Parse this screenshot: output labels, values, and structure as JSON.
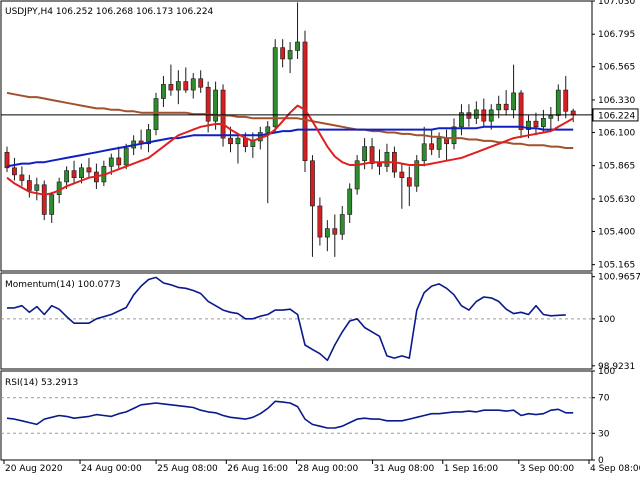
{
  "colors": {
    "background": "#ffffff",
    "frame": "#000000",
    "bull": "#2e8b2e",
    "bear": "#d42020",
    "wick": "#1a1a1a",
    "ma_fast": "#e02020",
    "ma_mid": "#1020c0",
    "ma_slow": "#a0522d",
    "indicator": "#0a1a8c",
    "level_line": "#9a9a9a",
    "price_tag_bg": "#ffffff",
    "price_tag_text": "#000000"
  },
  "chart_data": [
    {
      "type": "candlestick",
      "title": "USDJPY,H4  106.252 106.268 106.173 106.224",
      "ylim": [
        105.12,
        107.03
      ],
      "y_ticks": [
        "107.030",
        "106.795",
        "106.565",
        "106.330",
        "106.100",
        "105.865",
        "105.630",
        "105.400",
        "105.165"
      ],
      "y_tick_values": [
        107.03,
        106.795,
        106.565,
        106.33,
        106.1,
        105.865,
        105.63,
        105.4,
        105.165
      ],
      "current_price": "106.224",
      "current_price_value": 106.224,
      "candles": [
        {
          "o": 105.96,
          "h": 106.0,
          "l": 105.82,
          "c": 105.85
        },
        {
          "o": 105.85,
          "h": 105.92,
          "l": 105.76,
          "c": 105.8
        },
        {
          "o": 105.8,
          "h": 105.86,
          "l": 105.72,
          "c": 105.76
        },
        {
          "o": 105.76,
          "h": 105.8,
          "l": 105.64,
          "c": 105.69
        },
        {
          "o": 105.69,
          "h": 105.78,
          "l": 105.62,
          "c": 105.73
        },
        {
          "o": 105.73,
          "h": 105.76,
          "l": 105.48,
          "c": 105.52
        },
        {
          "o": 105.52,
          "h": 105.68,
          "l": 105.46,
          "c": 105.66
        },
        {
          "o": 105.66,
          "h": 105.78,
          "l": 105.6,
          "c": 105.75
        },
        {
          "o": 105.75,
          "h": 105.86,
          "l": 105.7,
          "c": 105.83
        },
        {
          "o": 105.83,
          "h": 105.9,
          "l": 105.74,
          "c": 105.78
        },
        {
          "o": 105.78,
          "h": 105.88,
          "l": 105.74,
          "c": 105.85
        },
        {
          "o": 105.85,
          "h": 105.92,
          "l": 105.78,
          "c": 105.82
        },
        {
          "o": 105.82,
          "h": 105.88,
          "l": 105.7,
          "c": 105.75
        },
        {
          "o": 105.75,
          "h": 105.9,
          "l": 105.72,
          "c": 105.86
        },
        {
          "o": 105.86,
          "h": 105.95,
          "l": 105.8,
          "c": 105.92
        },
        {
          "o": 105.92,
          "h": 106.0,
          "l": 105.84,
          "c": 105.87
        },
        {
          "o": 105.87,
          "h": 106.02,
          "l": 105.84,
          "c": 105.99
        },
        {
          "o": 105.99,
          "h": 106.08,
          "l": 105.94,
          "c": 106.04
        },
        {
          "o": 106.04,
          "h": 106.12,
          "l": 105.98,
          "c": 106.02
        },
        {
          "o": 106.02,
          "h": 106.16,
          "l": 105.96,
          "c": 106.12
        },
        {
          "o": 106.12,
          "h": 106.38,
          "l": 106.08,
          "c": 106.34
        },
        {
          "o": 106.34,
          "h": 106.5,
          "l": 106.28,
          "c": 106.44
        },
        {
          "o": 106.44,
          "h": 106.58,
          "l": 106.36,
          "c": 106.4
        },
        {
          "o": 106.4,
          "h": 106.54,
          "l": 106.3,
          "c": 106.46
        },
        {
          "o": 106.46,
          "h": 106.56,
          "l": 106.38,
          "c": 106.4
        },
        {
          "o": 106.4,
          "h": 106.52,
          "l": 106.34,
          "c": 106.48
        },
        {
          "o": 106.48,
          "h": 106.54,
          "l": 106.38,
          "c": 106.42
        },
        {
          "o": 106.42,
          "h": 106.46,
          "l": 106.1,
          "c": 106.18
        },
        {
          "o": 106.18,
          "h": 106.46,
          "l": 106.12,
          "c": 106.4
        },
        {
          "o": 106.4,
          "h": 106.44,
          "l": 106.0,
          "c": 106.06
        },
        {
          "o": 106.06,
          "h": 106.14,
          "l": 105.96,
          "c": 106.02
        },
        {
          "o": 106.02,
          "h": 106.08,
          "l": 105.88,
          "c": 106.06
        },
        {
          "o": 106.06,
          "h": 106.1,
          "l": 105.96,
          "c": 106.0
        },
        {
          "o": 106.0,
          "h": 106.1,
          "l": 105.92,
          "c": 106.04
        },
        {
          "o": 106.04,
          "h": 106.14,
          "l": 105.98,
          "c": 106.1
        },
        {
          "o": 106.1,
          "h": 106.18,
          "l": 105.6,
          "c": 106.14
        },
        {
          "o": 106.14,
          "h": 106.76,
          "l": 106.1,
          "c": 106.7
        },
        {
          "o": 106.7,
          "h": 106.76,
          "l": 106.56,
          "c": 106.62
        },
        {
          "o": 106.62,
          "h": 106.74,
          "l": 106.52,
          "c": 106.68
        },
        {
          "o": 106.68,
          "h": 107.02,
          "l": 106.62,
          "c": 106.74
        },
        {
          "o": 106.74,
          "h": 106.82,
          "l": 105.82,
          "c": 105.9
        },
        {
          "o": 105.9,
          "h": 105.94,
          "l": 105.22,
          "c": 105.58
        },
        {
          "o": 105.58,
          "h": 105.64,
          "l": 105.3,
          "c": 105.36
        },
        {
          "o": 105.36,
          "h": 105.48,
          "l": 105.26,
          "c": 105.42
        },
        {
          "o": 105.42,
          "h": 105.52,
          "l": 105.22,
          "c": 105.38
        },
        {
          "o": 105.38,
          "h": 105.58,
          "l": 105.34,
          "c": 105.52
        },
        {
          "o": 105.52,
          "h": 105.74,
          "l": 105.46,
          "c": 105.7
        },
        {
          "o": 105.7,
          "h": 105.94,
          "l": 105.66,
          "c": 105.9
        },
        {
          "o": 105.9,
          "h": 106.06,
          "l": 105.84,
          "c": 106.0
        },
        {
          "o": 106.0,
          "h": 106.06,
          "l": 105.84,
          "c": 105.88
        },
        {
          "o": 105.88,
          "h": 105.98,
          "l": 105.8,
          "c": 105.86
        },
        {
          "o": 105.86,
          "h": 106.02,
          "l": 105.82,
          "c": 105.96
        },
        {
          "o": 105.96,
          "h": 106.0,
          "l": 105.78,
          "c": 105.82
        },
        {
          "o": 105.82,
          "h": 105.88,
          "l": 105.56,
          "c": 105.78
        },
        {
          "o": 105.78,
          "h": 105.86,
          "l": 105.58,
          "c": 105.72
        },
        {
          "o": 105.72,
          "h": 105.94,
          "l": 105.68,
          "c": 105.9
        },
        {
          "o": 105.9,
          "h": 106.14,
          "l": 105.86,
          "c": 106.02
        },
        {
          "o": 106.02,
          "h": 106.12,
          "l": 105.94,
          "c": 105.98
        },
        {
          "o": 105.98,
          "h": 106.1,
          "l": 105.92,
          "c": 106.06
        },
        {
          "o": 106.06,
          "h": 106.12,
          "l": 105.9,
          "c": 106.02
        },
        {
          "o": 106.02,
          "h": 106.2,
          "l": 105.98,
          "c": 106.14
        },
        {
          "o": 106.14,
          "h": 106.3,
          "l": 106.08,
          "c": 106.24
        },
        {
          "o": 106.24,
          "h": 106.3,
          "l": 106.14,
          "c": 106.2
        },
        {
          "o": 106.2,
          "h": 106.32,
          "l": 106.16,
          "c": 106.26
        },
        {
          "o": 106.26,
          "h": 106.34,
          "l": 106.14,
          "c": 106.18
        },
        {
          "o": 106.18,
          "h": 106.3,
          "l": 106.12,
          "c": 106.26
        },
        {
          "o": 106.26,
          "h": 106.36,
          "l": 106.2,
          "c": 106.3
        },
        {
          "o": 106.3,
          "h": 106.4,
          "l": 106.22,
          "c": 106.26
        },
        {
          "o": 106.26,
          "h": 106.58,
          "l": 106.2,
          "c": 106.38
        },
        {
          "o": 106.38,
          "h": 106.4,
          "l": 106.06,
          "c": 106.12
        },
        {
          "o": 106.12,
          "h": 106.22,
          "l": 106.06,
          "c": 106.18
        },
        {
          "o": 106.18,
          "h": 106.24,
          "l": 106.08,
          "c": 106.14
        },
        {
          "o": 106.14,
          "h": 106.26,
          "l": 106.1,
          "c": 106.2
        },
        {
          "o": 106.2,
          "h": 106.28,
          "l": 106.12,
          "c": 106.22
        },
        {
          "o": 106.22,
          "h": 106.44,
          "l": 106.18,
          "c": 106.4
        },
        {
          "o": 106.4,
          "h": 106.5,
          "l": 106.2,
          "c": 106.25
        },
        {
          "o": 106.252,
          "h": 106.268,
          "l": 106.173,
          "c": 106.224
        }
      ],
      "ma_fast": [
        105.78,
        105.74,
        105.71,
        105.68,
        105.67,
        105.66,
        105.67,
        105.69,
        105.72,
        105.74,
        105.76,
        105.78,
        105.79,
        105.8,
        105.82,
        105.84,
        105.86,
        105.88,
        105.9,
        105.92,
        105.96,
        106.0,
        106.04,
        106.08,
        106.1,
        106.12,
        106.14,
        106.15,
        106.16,
        106.16,
        106.12,
        106.09,
        106.06,
        106.04,
        106.06,
        106.08,
        106.12,
        106.18,
        106.24,
        106.29,
        106.26,
        106.18,
        106.09,
        106.0,
        105.93,
        105.89,
        105.87,
        105.87,
        105.88,
        105.89,
        105.89,
        105.89,
        105.89,
        105.88,
        105.87,
        105.87,
        105.87,
        105.88,
        105.89,
        105.9,
        105.91,
        105.92,
        105.94,
        105.96,
        105.98,
        106.0,
        106.02,
        106.04,
        106.06,
        106.07,
        106.08,
        106.09,
        106.1,
        106.11,
        106.14,
        106.17,
        106.2
      ],
      "ma_mid": [
        105.86,
        105.87,
        105.88,
        105.88,
        105.89,
        105.89,
        105.9,
        105.91,
        105.92,
        105.93,
        105.94,
        105.95,
        105.96,
        105.97,
        105.98,
        105.99,
        106.0,
        106.01,
        106.02,
        106.03,
        106.04,
        106.05,
        106.06,
        106.06,
        106.07,
        106.08,
        106.08,
        106.08,
        106.08,
        106.08,
        106.08,
        106.08,
        106.08,
        106.08,
        106.08,
        106.09,
        106.1,
        106.11,
        106.11,
        106.12,
        106.12,
        106.12,
        106.12,
        106.12,
        106.12,
        106.12,
        106.12,
        106.12,
        106.12,
        106.12,
        106.12,
        106.12,
        106.12,
        106.12,
        106.12,
        106.12,
        106.12,
        106.12,
        106.13,
        106.13,
        106.13,
        106.13,
        106.13,
        106.13,
        106.14,
        106.14,
        106.14,
        106.14,
        106.14,
        106.14,
        106.13,
        106.13,
        106.12,
        106.12,
        106.12,
        106.12,
        106.12
      ],
      "ma_slow": [
        106.38,
        106.37,
        106.36,
        106.35,
        106.35,
        106.34,
        106.33,
        106.32,
        106.31,
        106.3,
        106.29,
        106.28,
        106.27,
        106.27,
        106.26,
        106.26,
        106.25,
        106.25,
        106.24,
        106.24,
        106.24,
        106.24,
        106.24,
        106.24,
        106.24,
        106.23,
        106.23,
        106.23,
        106.22,
        106.22,
        106.22,
        106.21,
        106.21,
        106.2,
        106.2,
        106.2,
        106.2,
        106.2,
        106.2,
        106.2,
        106.19,
        106.18,
        106.17,
        106.16,
        106.15,
        106.14,
        106.13,
        106.12,
        106.12,
        106.11,
        106.11,
        106.1,
        106.1,
        106.09,
        106.09,
        106.08,
        106.08,
        106.07,
        106.07,
        106.06,
        106.06,
        106.06,
        106.05,
        106.05,
        106.04,
        106.04,
        106.03,
        106.03,
        106.02,
        106.02,
        106.01,
        106.01,
        106.01,
        106.0,
        106.0,
        105.99,
        105.99
      ]
    },
    {
      "type": "line",
      "title": "Momentum(14) 100.0773",
      "ylim": [
        98.85,
        101.05
      ],
      "y_ticks": [
        "100.9657",
        "100",
        "98.9231"
      ],
      "y_tick_values": [
        100.9657,
        100,
        98.9231
      ],
      "levels": [
        100
      ],
      "values": [
        100.25,
        100.25,
        100.3,
        100.15,
        100.28,
        100.1,
        100.3,
        100.22,
        100.05,
        99.9,
        99.9,
        99.9,
        100.0,
        100.05,
        100.1,
        100.18,
        100.26,
        100.55,
        100.75,
        100.9,
        100.95,
        100.82,
        100.78,
        100.72,
        100.7,
        100.65,
        100.58,
        100.4,
        100.3,
        100.2,
        100.15,
        100.12,
        100.0,
        100.0,
        100.06,
        100.1,
        100.2,
        100.2,
        100.22,
        100.1,
        99.4,
        99.3,
        99.2,
        99.05,
        99.4,
        99.7,
        99.95,
        100.0,
        99.8,
        99.7,
        99.6,
        99.15,
        99.1,
        99.15,
        99.1,
        100.2,
        100.6,
        100.75,
        100.8,
        100.7,
        100.55,
        100.3,
        100.2,
        100.4,
        100.5,
        100.48,
        100.4,
        100.22,
        100.12,
        100.15,
        100.1,
        100.3,
        100.1,
        100.07,
        100.08,
        100.09
      ]
    },
    {
      "type": "line",
      "title": "RSI(14) 53.2913",
      "ylim": [
        0,
        100
      ],
      "y_ticks": [
        "100",
        "70",
        "30",
        "0"
      ],
      "y_tick_values": [
        100,
        70,
        30,
        0
      ],
      "levels": [
        70,
        30
      ],
      "values": [
        47,
        46,
        44,
        42,
        40,
        46,
        48,
        50,
        49,
        47,
        48,
        49,
        51,
        50,
        49,
        52,
        54,
        58,
        62,
        63,
        64,
        63,
        62,
        61,
        60,
        59,
        56,
        54,
        53,
        50,
        48,
        47,
        46,
        48,
        52,
        58,
        66,
        65,
        64,
        60,
        46,
        40,
        38,
        36,
        36,
        38,
        42,
        46,
        47,
        46,
        46,
        44,
        44,
        44,
        46,
        48,
        50,
        52,
        52,
        53,
        54,
        54,
        55,
        54,
        56,
        56,
        56,
        55,
        56,
        50,
        52,
        51,
        52,
        56,
        57,
        53,
        53
      ]
    }
  ],
  "x_labels": [
    "20 Aug 2020",
    "24 Aug 00:00",
    "25 Aug 08:00",
    "26 Aug 16:00",
    "28 Aug 00:00",
    "31 Aug 08:00",
    "1 Sep 16:00",
    "3 Sep 00:00",
    "4 Sep 08:00"
  ],
  "x_label_index": [
    0,
    13,
    26,
    38,
    50,
    63,
    75,
    88,
    100
  ]
}
